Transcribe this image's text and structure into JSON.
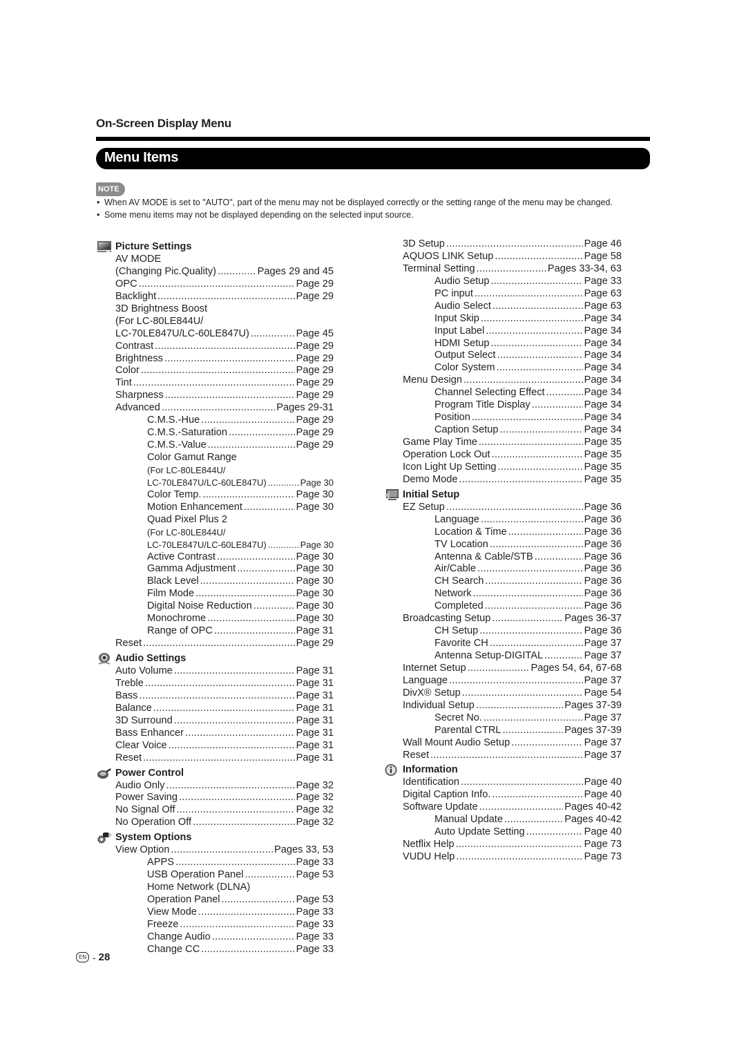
{
  "header": {
    "section_title": "On-Screen Display Menu",
    "bar_title": "Menu Items"
  },
  "note": {
    "badge": "NOTE",
    "items": [
      "When AV MODE is set to \"AUTO\", part of the menu may not be displayed correctly or the setting range of the menu may be changed.",
      "Some menu items may not be displayed depending on the selected input source."
    ]
  },
  "left_column": [
    {
      "title": "Picture Settings",
      "icon": "tv-monitor-icon",
      "rows": [
        {
          "label": "AV MODE",
          "page": "",
          "level": 1
        },
        {
          "label": "(Changing Pic.Quality)",
          "page": "Pages 29 and 45",
          "level": 1
        },
        {
          "label": "OPC",
          "page": "Page 29",
          "level": 1
        },
        {
          "label": "Backlight",
          "page": "Page 29",
          "level": 1
        },
        {
          "label": "3D Brightness Boost",
          "page": "",
          "level": 1
        },
        {
          "label": "(For LC-80LE844U/",
          "page": "",
          "level": 1
        },
        {
          "label": "LC-70LE847U/LC-60LE847U)",
          "page": "Page 45",
          "level": 1
        },
        {
          "label": "Contrast",
          "page": "Page 29",
          "level": 1
        },
        {
          "label": "Brightness",
          "page": "Page 29",
          "level": 1
        },
        {
          "label": "Color",
          "page": "Page 29",
          "level": 1
        },
        {
          "label": "Tint",
          "page": "Page 29",
          "level": 1
        },
        {
          "label": "Sharpness",
          "page": "Page 29",
          "level": 1
        },
        {
          "label": "Advanced",
          "page": "Pages 29-31",
          "level": 1
        },
        {
          "label": "C.M.S.-Hue",
          "page": "Page 29",
          "level": 2
        },
        {
          "label": "C.M.S.-Saturation",
          "page": "Page 29",
          "level": 2
        },
        {
          "label": "C.M.S.-Value",
          "page": "Page 29",
          "level": 2
        },
        {
          "label": "Color Gamut Range",
          "page": "",
          "level": 2
        },
        {
          "label": "(For LC-80LE844U/",
          "page": "",
          "level": 2,
          "small": true
        },
        {
          "label": "LC-70LE847U/LC-60LE847U)",
          "page": "Page 30",
          "level": 2,
          "small": true
        },
        {
          "label": "Color Temp.",
          "page": "Page 30",
          "level": 2
        },
        {
          "label": "Motion Enhancement",
          "page": "Page 30",
          "level": 2
        },
        {
          "label": "Quad Pixel Plus 2",
          "page": "",
          "level": 2
        },
        {
          "label": "(For LC-80LE844U/",
          "page": "",
          "level": 2,
          "small": true
        },
        {
          "label": "LC-70LE847U/LC-60LE847U)",
          "page": "Page 30",
          "level": 2,
          "small": true
        },
        {
          "label": "Active Contrast",
          "page": "Page 30",
          "level": 2
        },
        {
          "label": "Gamma Adjustment",
          "page": "Page 30",
          "level": 2
        },
        {
          "label": "Black Level",
          "page": "Page 30",
          "level": 2
        },
        {
          "label": "Film Mode",
          "page": "Page 30",
          "level": 2
        },
        {
          "label": "Digital Noise Reduction",
          "page": "Page 30",
          "level": 2
        },
        {
          "label": "Monochrome",
          "page": "Page 30",
          "level": 2
        },
        {
          "label": "Range of OPC",
          "page": "Page 31",
          "level": 2
        },
        {
          "label": "Reset",
          "page": "Page 29",
          "level": 1
        }
      ]
    },
    {
      "title": "Audio Settings",
      "icon": "speaker-icon",
      "rows": [
        {
          "label": "Auto Volume",
          "page": "Page 31",
          "level": 1
        },
        {
          "label": "Treble",
          "page": "Page 31",
          "level": 1
        },
        {
          "label": "Bass",
          "page": "Page 31",
          "level": 1
        },
        {
          "label": "Balance",
          "page": "Page 31",
          "level": 1
        },
        {
          "label": "3D Surround",
          "page": "Page 31",
          "level": 1
        },
        {
          "label": "Bass Enhancer",
          "page": "Page 31",
          "level": 1
        },
        {
          "label": "Clear Voice",
          "page": "Page 31",
          "level": 1
        },
        {
          "label": "Reset",
          "page": "Page 31",
          "level": 1
        }
      ]
    },
    {
      "title": "Power Control",
      "icon": "power-plug-icon",
      "rows": [
        {
          "label": "Audio Only",
          "page": "Page 32",
          "level": 1
        },
        {
          "label": "Power Saving",
          "page": "Page 32",
          "level": 1
        },
        {
          "label": "No Signal Off",
          "page": "Page 32",
          "level": 1
        },
        {
          "label": "No Operation Off",
          "page": "Page 32",
          "level": 1
        }
      ]
    },
    {
      "title": "System Options",
      "icon": "gear-plug-icon",
      "rows": [
        {
          "label": "View Option",
          "page": "Pages 33, 53",
          "level": 1
        },
        {
          "label": "APPS",
          "page": "Page 33",
          "level": 2
        },
        {
          "label": "USB Operation Panel",
          "page": "Page 53",
          "level": 2
        },
        {
          "label": "Home Network (DLNA)",
          "page": "",
          "level": 2
        },
        {
          "label": "Operation Panel",
          "page": "Page 53",
          "level": 2
        },
        {
          "label": "View Mode",
          "page": "Page 33",
          "level": 2
        },
        {
          "label": "Freeze",
          "page": "Page 33",
          "level": 2
        },
        {
          "label": "Change Audio",
          "page": "Page 33",
          "level": 2
        },
        {
          "label": "Change CC",
          "page": "Page 33",
          "level": 2
        }
      ]
    }
  ],
  "right_column": [
    {
      "title": "",
      "icon": "",
      "rows": [
        {
          "label": "3D Setup",
          "page": "Page 46",
          "level": 1
        },
        {
          "label": "AQUOS LINK Setup",
          "page": "Page 58",
          "level": 1
        },
        {
          "label": "Terminal Setting",
          "page": "Pages 33-34, 63",
          "level": 1
        },
        {
          "label": "Audio Setup",
          "page": "Page 33",
          "level": 2
        },
        {
          "label": "PC input",
          "page": "Page 63",
          "level": 2
        },
        {
          "label": "Audio Select",
          "page": "Page 63",
          "level": 2
        },
        {
          "label": "Input Skip",
          "page": "Page 34",
          "level": 2
        },
        {
          "label": "Input Label",
          "page": "Page 34",
          "level": 2
        },
        {
          "label": "HDMI Setup",
          "page": "Page 34",
          "level": 2
        },
        {
          "label": "Output Select",
          "page": "Page 34",
          "level": 2
        },
        {
          "label": "Color System",
          "page": "Page 34",
          "level": 2
        },
        {
          "label": "Menu Design",
          "page": "Page 34",
          "level": 1
        },
        {
          "label": "Channel Selecting Effect",
          "page": "Page 34",
          "level": 2
        },
        {
          "label": "Program Title Display",
          "page": "Page 34",
          "level": 2
        },
        {
          "label": "Position",
          "page": "Page 34",
          "level": 2
        },
        {
          "label": "Caption Setup",
          "page": "Page 34",
          "level": 2
        },
        {
          "label": "Game Play Time",
          "page": "Page 35",
          "level": 1
        },
        {
          "label": "Operation Lock Out",
          "page": "Page 35",
          "level": 1
        },
        {
          "label": "Icon Light Up Setting",
          "page": "Page 35",
          "level": 1
        },
        {
          "label": "Demo Mode",
          "page": "Page 35",
          "level": 1
        }
      ]
    },
    {
      "title": "Initial Setup",
      "icon": "setup-monitor-icon",
      "rows": [
        {
          "label": "EZ Setup",
          "page": "Page 36",
          "level": 1
        },
        {
          "label": "Language",
          "page": "Page 36",
          "level": 2
        },
        {
          "label": "Location & Time",
          "page": "Page 36",
          "level": 2
        },
        {
          "label": "TV Location",
          "page": "Page 36",
          "level": 2
        },
        {
          "label": "Antenna & Cable/STB",
          "page": "Page 36",
          "level": 2
        },
        {
          "label": "Air/Cable",
          "page": "Page 36",
          "level": 2
        },
        {
          "label": "CH Search",
          "page": "Page 36",
          "level": 2
        },
        {
          "label": "Network",
          "page": "Page 36",
          "level": 2
        },
        {
          "label": "Completed",
          "page": "Page 36",
          "level": 2
        },
        {
          "label": "Broadcasting Setup",
          "page": "Pages 36-37",
          "level": 1
        },
        {
          "label": "CH Setup",
          "page": "Page 36",
          "level": 2
        },
        {
          "label": "Favorite CH",
          "page": "Page 37",
          "level": 2
        },
        {
          "label": "Antenna Setup-DIGITAL",
          "page": "Page 37",
          "level": 2
        },
        {
          "label": "Internet Setup",
          "page": "Pages 54, 64, 67-68",
          "level": 1
        },
        {
          "label": "Language",
          "page": "Page 37",
          "level": 1
        },
        {
          "label": "DivX® Setup",
          "page": "Page 54",
          "level": 1
        },
        {
          "label": "Individual Setup",
          "page": "Pages 37-39",
          "level": 1
        },
        {
          "label": "Secret No.",
          "page": "Page 37",
          "level": 2
        },
        {
          "label": "Parental CTRL",
          "page": "Pages 37-39",
          "level": 2
        },
        {
          "label": "Wall Mount Audio Setup",
          "page": "Page 37",
          "level": 1
        },
        {
          "label": "Reset",
          "page": "Page 37",
          "level": 1
        }
      ]
    },
    {
      "title": "Information",
      "icon": "info-icon",
      "rows": [
        {
          "label": "Identification",
          "page": "Page 40",
          "level": 1
        },
        {
          "label": "Digital Caption Info.",
          "page": "Page 40",
          "level": 1
        },
        {
          "label": "Software Update",
          "page": "Pages 40-42",
          "level": 1
        },
        {
          "label": "Manual Update",
          "page": "Pages 40-42",
          "level": 2
        },
        {
          "label": "Auto Update Setting",
          "page": "Page 40",
          "level": 2
        },
        {
          "label": "Netflix Help",
          "page": "Page 73",
          "level": 1
        },
        {
          "label": "VUDU Help",
          "page": "Page 73",
          "level": 1
        }
      ]
    }
  ],
  "footer": {
    "language_badge": "EN",
    "separator": "-",
    "page_number": "28"
  }
}
